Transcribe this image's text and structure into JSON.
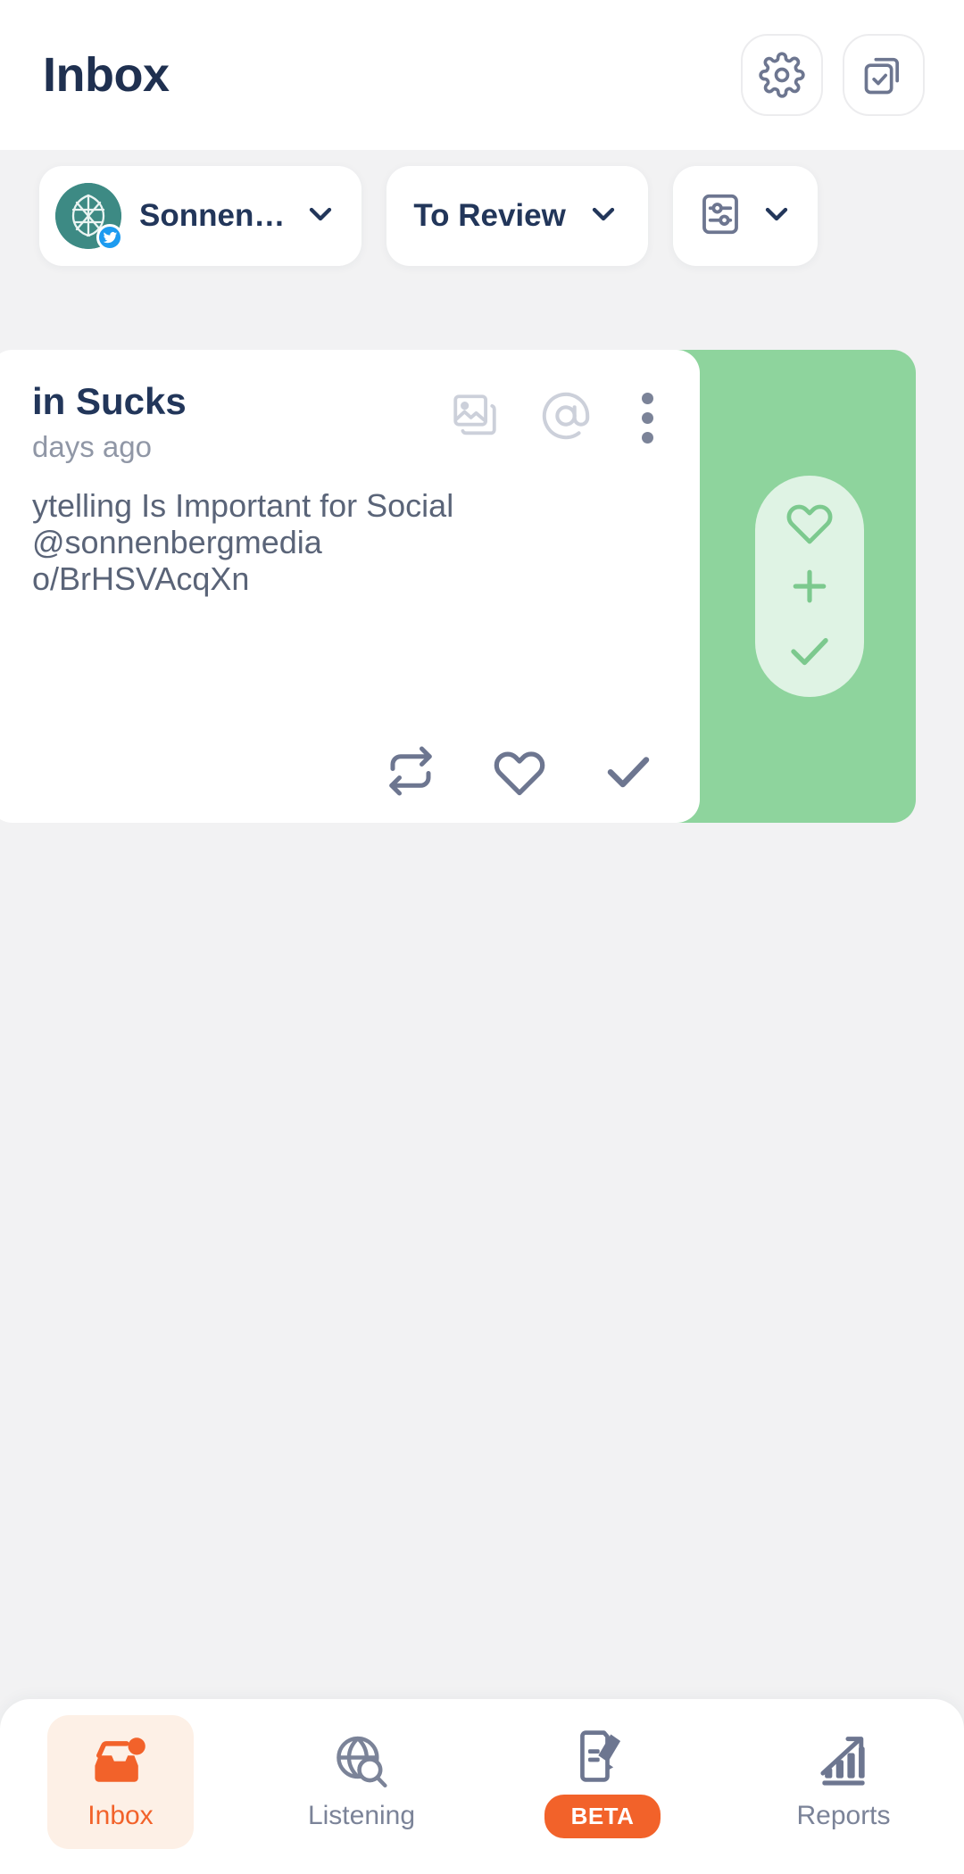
{
  "header": {
    "title": "Inbox",
    "settings_icon": "gear-icon",
    "tasks_icon": "checklist-copy-icon"
  },
  "filters": {
    "account": {
      "label": "Sonnen…",
      "avatar_icon": "account-avatar",
      "network_badge": "twitter-badge-icon",
      "chevron": "chevron-down-icon"
    },
    "status": {
      "label": "To Review",
      "chevron": "chevron-down-icon"
    },
    "advanced": {
      "icon": "sliders-filter-icon",
      "chevron": "chevron-down-icon"
    }
  },
  "message": {
    "title": "in Sucks",
    "time": "days ago",
    "media_icon": "images-icon",
    "mention_icon": "at-mention-icon",
    "more_icon": "more-vertical-icon",
    "lines": [
      "ytelling Is Important for Social",
      " @sonnenbergmedia",
      "o/BrHSVAcqXn"
    ],
    "actions": [
      {
        "name": "retweet-icon"
      },
      {
        "name": "like-heart-icon"
      },
      {
        "name": "approve-check-icon"
      }
    ],
    "swipe_actions": [
      {
        "name": "swipe-like-heart-icon"
      },
      {
        "name": "swipe-add-plus-icon"
      },
      {
        "name": "swipe-approve-check-icon"
      }
    ]
  },
  "colors": {
    "accent_orange": "#f2622a",
    "swipe_green": "#8ed49d",
    "title_navy": "#22365a",
    "muted_gray": "#7b8398"
  },
  "bottom_nav": [
    {
      "label": "Inbox",
      "icon": "inbox-badge-icon",
      "active": true,
      "badge": null
    },
    {
      "label": "Listening",
      "icon": "globe-search-icon",
      "active": false,
      "badge": null
    },
    {
      "label": "",
      "icon": "publish-compose-icon",
      "active": false,
      "badge": "BETA"
    },
    {
      "label": "Reports",
      "icon": "bar-chart-arrow-icon",
      "active": false,
      "badge": null
    }
  ]
}
